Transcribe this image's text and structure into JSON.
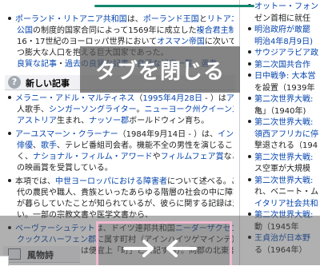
{
  "main": {
    "lines": [
      {
        "bullet": true,
        "parts": [
          [
            "lnk b",
            "ポーランド・リトアニア共和国"
          ],
          [
            "",
            "は、"
          ],
          [
            "lnk",
            "ポーランド王国"
          ],
          [
            "",
            "と"
          ],
          [
            "lnk",
            "リトアニア大"
          ]
        ]
      },
      {
        "bullet": false,
        "parts": [
          [
            "lnk",
            "公国"
          ],
          [
            "",
            "の制度的国家合同によって1569年に成立した"
          ],
          [
            "lnk",
            "複合君主制"
          ],
          [
            "",
            "国家。"
          ]
        ]
      },
      {
        "bullet": false,
        "parts": [
          [
            "",
            "16・17世紀のヨーロッパ世界において"
          ],
          [
            "lnk",
            "オスマン帝国"
          ],
          [
            "",
            "に次いで広大か"
          ]
        ]
      },
      {
        "bullet": false,
        "parts": [
          [
            "",
            "つ膨大な人口を抱える巨大国家であった。"
          ]
        ]
      },
      {
        "bullet": false,
        "parts": [
          [
            "lnk",
            "良質な記事"
          ],
          [
            "",
            "・"
          ],
          [
            "lnk",
            "過去の良質な記事"
          ],
          [
            "",
            "・"
          ],
          [
            "lnk",
            "良質な記事一覧"
          ],
          [
            "",
            "・"
          ],
          [
            "lnk",
            "選考"
          ]
        ]
      }
    ],
    "section_title": "新しい記事",
    "section_icon": "?",
    "entries": [
      {
        "bullet": true,
        "parts": [
          [
            "lnk b",
            "メラニー・アドル・マルティネス"
          ],
          [
            "",
            "（"
          ],
          [
            "lnk",
            "1995年4月28日"
          ],
          [
            "",
            " - ）は"
          ],
          [
            "lnk",
            "アメリカ"
          ]
        ]
      },
      {
        "bullet": false,
        "parts": [
          [
            "",
            "人歌手、"
          ],
          [
            "lnk",
            "シンガーソングライター"
          ],
          [
            "",
            "。"
          ],
          [
            "lnk",
            "ニューヨーク州クイーンズ区"
          ]
        ]
      },
      {
        "bullet": false,
        "parts": [
          [
            "lnk",
            "アストリア"
          ],
          [
            "",
            "生まれ、"
          ],
          [
            "lnk",
            "ナッソー郡"
          ],
          [
            "",
            "ボールドウィン育ち。"
          ]
        ]
      },
      {
        "bullet": true,
        "parts": [
          [
            "lnk b",
            "アーユスマーン・クラーナー"
          ],
          [
            "",
            "（1984年9月14日 - ）は、"
          ],
          [
            "lnk",
            "インド"
          ],
          [
            "",
            "の"
          ]
        ]
      },
      {
        "bullet": false,
        "parts": [
          [
            "lnk",
            "俳優"
          ],
          [
            "",
            "、"
          ],
          [
            "lnk",
            "歌手"
          ],
          [
            "",
            "、テレビ番組司会者。機能不全の男性を演じることが多"
          ]
        ]
      },
      {
        "bullet": false,
        "parts": [
          [
            "",
            "く、"
          ],
          [
            "lnk",
            "ナショナル・フィルム・アワード"
          ],
          [
            "",
            "や"
          ],
          [
            "lnk",
            "フィルムフェア賞"
          ],
          [
            "",
            "など複数"
          ]
        ]
      },
      {
        "bullet": false,
        "parts": [
          [
            "",
            "の映画賞を受賞している。"
          ]
        ]
      },
      {
        "bullet": true,
        "parts": [
          [
            "",
            "本項では、"
          ],
          [
            "lnk b",
            "中世ヨーロッパにおける障害者"
          ],
          [
            "",
            "について述べる。この時"
          ]
        ]
      },
      {
        "bullet": false,
        "parts": [
          [
            "",
            "代の農民や職人、貴族といったあらゆる階層の社会の中に障害者"
          ]
        ]
      },
      {
        "bullet": false,
        "parts": [
          [
            "",
            "が暮らしていたことが知られているが、彼らに関する記録は乏し"
          ]
        ]
      },
      {
        "bullet": false,
        "parts": [
          [
            "",
            "い。一部の宗教文書や医学文書から、"
          ]
        ]
      },
      {
        "bullet": true,
        "parts": [
          [
            "lnk b",
            "ベーヴァーシュテット"
          ],
          [
            "",
            "は、ドイツ連邦共和国"
          ],
          [
            "lnk",
            "ニーダーザクセン州"
          ]
        ]
      },
      {
        "bullet": false,
        "parts": [
          [
            "lnk",
            "クックスハーフェン郡"
          ],
          [
            "",
            "に属す町村（アインハイツゲマインデ）であ"
          ]
        ]
      },
      {
        "bullet": false,
        "parts": [
          [
            "",
            "る（以下、本項では便宜上「町」と表記する）。同郡の北東部"
          ]
        ]
      }
    ]
  },
  "side": {
    "lines": [
      {
        "bullet": true,
        "text": "オットー・フォン",
        "lnk": true
      },
      {
        "bullet": false,
        "text": "ゼン首相に就任",
        "lnk": false
      },
      {
        "bullet": true,
        "text": "明治政府が敢罷",
        "lnk": true
      },
      {
        "bullet": false,
        "text": "明治4年8月9日)",
        "lnk": true
      },
      {
        "bullet": true,
        "text": "サウジアラビア政",
        "lnk": true
      },
      {
        "bullet": true,
        "text": "第二次国共合作",
        "lnk": true
      },
      {
        "bullet": true,
        "text": "日中戦争: 大本営",
        "lnk": true
      },
      {
        "bullet": false,
        "text": "を設置（1939年",
        "lnk": false
      },
      {
        "bullet": true,
        "text": "第二次世界大戦:",
        "lnk": true
      },
      {
        "bullet": false,
        "text": "亀」（1940年)",
        "lnk": false
      },
      {
        "bullet": true,
        "text": "第二次世界大戦:",
        "lnk": true
      },
      {
        "bullet": false,
        "text": "領西アフリカに停",
        "lnk": true
      },
      {
        "bullet": false,
        "text": "撃退される（194",
        "lnk": false
      },
      {
        "bullet": true,
        "text": "第二次世界大戦:",
        "lnk": true
      },
      {
        "bullet": false,
        "text": "ス空軍が大規模",
        "lnk": false
      },
      {
        "bullet": true,
        "text": "第二次世界大戦:",
        "lnk": true
      },
      {
        "bullet": false,
        "text": "れ、ベニート・ム",
        "lnk": false
      },
      {
        "bullet": false,
        "text": "イタリア社会共和",
        "lnk": true
      },
      {
        "bullet": true,
        "text": "第二次世界大戦:",
        "lnk": true
      },
      {
        "bullet": false,
        "text": "動（1945年",
        "lnk": false
      },
      {
        "bullet": true,
        "text": "王貞治が日本野",
        "lnk": true
      },
      {
        "bullet": false,
        "text": "る（1964年）",
        "lnk": false
      }
    ],
    "section_title": "風物詩"
  },
  "overlay": {
    "close_tab_label": "タブを閉じる"
  },
  "colors": {
    "accent": "#14866d",
    "link": "#0645ad",
    "swipe_border": "#f2b8d0"
  }
}
